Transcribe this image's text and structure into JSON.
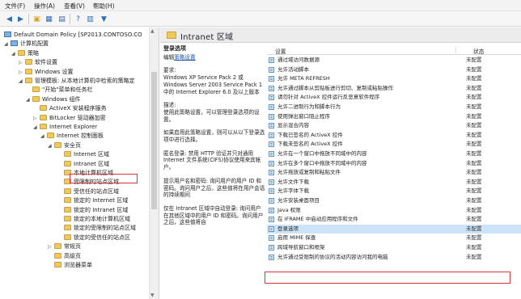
{
  "menu": [
    "文件(F)",
    "操作(A)",
    "查看(V)",
    "帮助(H)"
  ],
  "toolbar": [
    {
      "icon": "back-arrow-icon",
      "enabled": true
    },
    {
      "icon": "forward-arrow-icon",
      "enabled": true
    },
    {
      "icon": "up-folder-icon",
      "enabled": true
    },
    {
      "icon": "show-hide-tree-icon",
      "enabled": true
    },
    {
      "icon": "export-list-icon",
      "enabled": true
    },
    {
      "icon": "help-icon",
      "enabled": true
    },
    {
      "icon": "properties-icon",
      "enabled": true
    },
    {
      "icon": "filter-icon",
      "enabled": true
    }
  ],
  "tree": [
    {
      "label": "Default Domain Policy [SP2013.CONTOSO.CO",
      "icon": "policy",
      "expander": ""
    },
    {
      "label": "计算机配置",
      "icon": "computer",
      "expander": "◢"
    },
    {
      "label": "策略",
      "icon": "folder",
      "expander": "◢"
    },
    {
      "label": "软件设置",
      "icon": "folder",
      "expander": "▷"
    },
    {
      "label": "Windows 设置",
      "icon": "folder",
      "expander": "▷"
    },
    {
      "label": "管理模板: 从本地计算机中检索的策略定",
      "icon": "folder",
      "expander": "◢"
    },
    {
      "label": "\"开始\"菜单和任务栏",
      "icon": "folder",
      "expander": ""
    },
    {
      "label": "Windows 组件",
      "icon": "folder",
      "expander": "◢"
    },
    {
      "label": "ActiveX 安装程序服务",
      "icon": "folder",
      "expander": ""
    },
    {
      "label": "BitLocker 驱动器加密",
      "icon": "folder",
      "expander": "▷"
    },
    {
      "label": "Internet Explorer",
      "icon": "folder",
      "expander": "◢"
    },
    {
      "label": "Internet 控制面板",
      "icon": "folder",
      "expander": "◢"
    },
    {
      "label": "安全页",
      "icon": "folder",
      "expander": "◢"
    },
    {
      "label": "Internet 区域",
      "icon": "folder",
      "expander": ""
    },
    {
      "label": "Intranet 区域",
      "icon": "folder",
      "expander": "",
      "selected": true
    },
    {
      "label": "本地计算机区域",
      "icon": "folder",
      "expander": ""
    },
    {
      "label": "受限制的站点区域",
      "icon": "folder",
      "expander": ""
    },
    {
      "label": "受信任的站点区域",
      "icon": "folder",
      "expander": ""
    },
    {
      "label": "锁定的 Internet 区域",
      "icon": "folder",
      "expander": ""
    },
    {
      "label": "锁定的 Intranet 区域",
      "icon": "folder",
      "expander": ""
    },
    {
      "label": "锁定的本地计算机区域",
      "icon": "folder",
      "expander": ""
    },
    {
      "label": "锁定的受限制的站点区域",
      "icon": "folder",
      "expander": ""
    },
    {
      "label": "锁定的受信任的站点区",
      "icon": "folder",
      "expander": ""
    },
    {
      "label": "常规页",
      "icon": "folder",
      "expander": "▷"
    },
    {
      "label": "高级页",
      "icon": "folder",
      "expander": ""
    },
    {
      "label": "浏览器菜单",
      "icon": "folder",
      "expander": ""
    }
  ],
  "panel": {
    "title": "Intranet 区域"
  },
  "description": {
    "heading": "登录选项",
    "edit_prefix": "编辑",
    "edit_link": "策略设置",
    "requirement_label": "要求:",
    "requirement_text": "Windows XP Service Pack 2 或 Windows Server 2003 Service Pack 1 中的 Internet Explorer 6.0 及以上版本",
    "desc_label": "描述:",
    "desc_text": "使用此策略设置，可以管理登录选项的设置。",
    "p3": "如果启用此策略设置，则可以从以下登录选项中进行选择。",
    "p4": "匿名登录: 禁用 HTTP 验证并只对通用 Internet 文件系统(CIFS)协议使用来宾帐户。",
    "p5": "提示用户名和密码: 询问用户的用户 ID 和密码。询问用户之后，这些值将在用户会话的持续期间",
    "p6": "仅在 Intranet 区域中自动登录: 询问用户在其他区域中的用户 ID 和密码。询问用户之后，这些值将自"
  },
  "settings": {
    "col_setting": "设置",
    "col_state": "状态",
    "rows": [
      {
        "name": "通过域访问数据源",
        "state": "未配置"
      },
      {
        "name": "允许活动脚本",
        "state": "未配置"
      },
      {
        "name": "允许 META REFRESH",
        "state": "未配置"
      },
      {
        "name": "允许通过脚本从剪贴板进行剪切、复制或粘贴操作",
        "state": "未配置"
      },
      {
        "name": "请勿针对 ActiveX 控件运行反恶意软件程序",
        "state": "未配置"
      },
      {
        "name": "允许二进制行为和脚本行为",
        "state": "未配置"
      },
      {
        "name": "使用弹出窗口阻止程序",
        "state": "未配置"
      },
      {
        "name": "显示混合内容",
        "state": "未配置"
      },
      {
        "name": "下载已签名的 ActiveX 控件",
        "state": "未配置"
      },
      {
        "name": "下载未签名的 ActiveX 控件",
        "state": "未配置"
      },
      {
        "name": "允许在一个窗口中拖放不同域中的内容",
        "state": "未配置"
      },
      {
        "name": "允许在多个窗口中拖放不同域中的内容",
        "state": "未配置"
      },
      {
        "name": "允许拖放或复制和粘贴文件",
        "state": "未配置"
      },
      {
        "name": "允许文件下载",
        "state": "未配置"
      },
      {
        "name": "允许字体下载",
        "state": "未配置"
      },
      {
        "name": "允许安装桌面项目",
        "state": "未配置"
      },
      {
        "name": "Java 权限",
        "state": "未配置"
      },
      {
        "name": "在 IFRAME 中启动应用程序和文件",
        "state": "未配置"
      },
      {
        "name": "登录选项",
        "state": "未配置",
        "selected": true
      },
      {
        "name": "启用 MIME 探查",
        "state": "未配置"
      },
      {
        "name": "跨域导航窗口和框架",
        "state": "未配置"
      },
      {
        "name": "允许通过受限制的协议的活动内容访问我的电脑",
        "state": "未配置"
      }
    ]
  }
}
